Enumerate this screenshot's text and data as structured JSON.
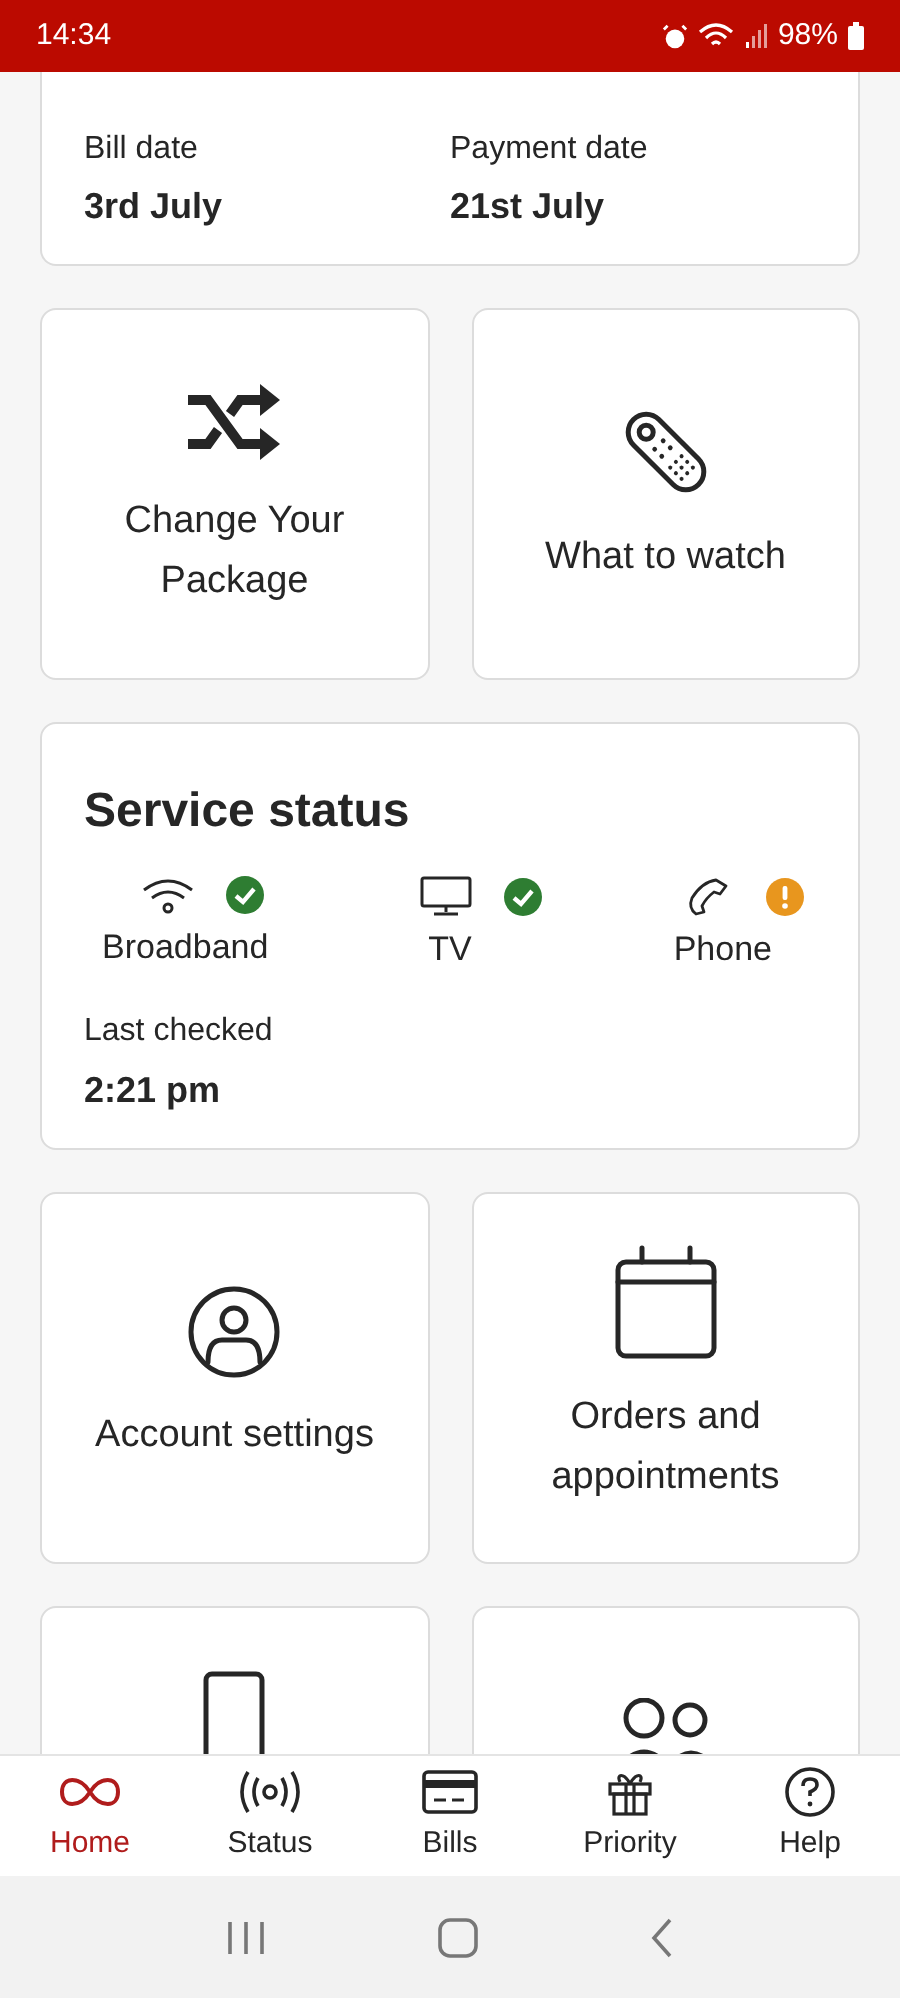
{
  "status_bar": {
    "time": "14:34",
    "battery": "98%"
  },
  "bill_card": {
    "fields": [
      {
        "label": "Bill date",
        "value": "3rd July"
      },
      {
        "label": "Payment date",
        "value": "21st July"
      }
    ]
  },
  "tiles_top": [
    {
      "label": "Change Your Package"
    },
    {
      "label": "What to watch"
    }
  ],
  "service_status": {
    "title": "Service status",
    "services": [
      {
        "name": "Broadband",
        "kind": "ok"
      },
      {
        "name": "TV",
        "kind": "ok"
      },
      {
        "name": "Phone",
        "kind": "warning"
      }
    ],
    "last_checked_label": "Last checked",
    "last_checked": "2:21 pm"
  },
  "tiles_bottom": [
    {
      "label": "Account settings"
    },
    {
      "label": "Orders and appointments"
    }
  ],
  "bottom_nav": [
    {
      "label": "Home",
      "selected": true
    },
    {
      "label": "Status",
      "selected": false
    },
    {
      "label": "Bills",
      "selected": false
    },
    {
      "label": "Priority",
      "selected": false
    },
    {
      "label": "Help",
      "selected": false
    }
  ]
}
